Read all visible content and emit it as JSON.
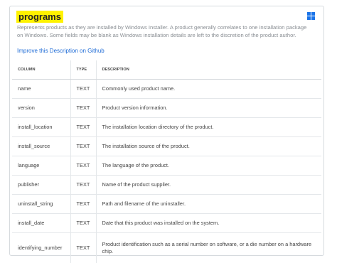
{
  "table_name": "programs",
  "description": "Represents products as they are installed by Windows Installer. A product generally correlates to one installation package on Windows. Some fields may be blank as Windows installation details are left to the discretion of the product author.",
  "improve_link": "Improve this Description on Github",
  "platform_icon": "windows-logo-icon",
  "colors": {
    "highlight": "#fff200",
    "link": "#1e6bd6",
    "windows": "#1a73e8"
  },
  "headers": [
    "COLUMN",
    "TYPE",
    "DESCRIPTION"
  ],
  "rows": [
    {
      "column": "name",
      "type": "TEXT",
      "description": "Commonly used product name."
    },
    {
      "column": "version",
      "type": "TEXT",
      "description": "Product version information."
    },
    {
      "column": "install_location",
      "type": "TEXT",
      "description": "The installation location directory of the product."
    },
    {
      "column": "install_source",
      "type": "TEXT",
      "description": "The installation source of the product."
    },
    {
      "column": "language",
      "type": "TEXT",
      "description": "The language of the product."
    },
    {
      "column": "publisher",
      "type": "TEXT",
      "description": "Name of the product supplier."
    },
    {
      "column": "uninstall_string",
      "type": "TEXT",
      "description": "Path and filename of the uninstaller."
    },
    {
      "column": "install_date",
      "type": "TEXT",
      "description": "Date that this product was installed on the system."
    },
    {
      "column": "identifying_number",
      "type": "TEXT",
      "description": "Product identification such as a serial number on software, or a die number on a hardware chip."
    }
  ]
}
